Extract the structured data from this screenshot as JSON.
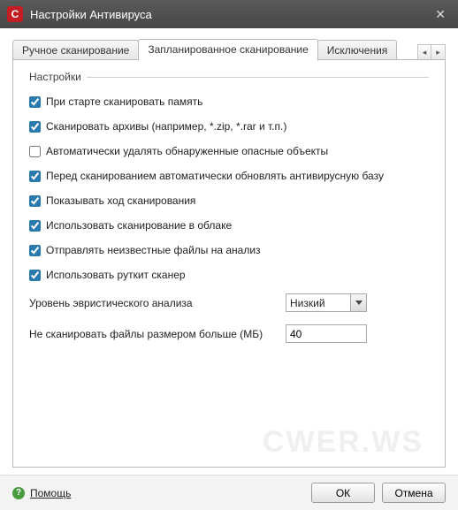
{
  "window": {
    "title": "Настройки Антивируса",
    "logo_text": "C"
  },
  "tabs": [
    {
      "label": "Ручное сканирование"
    },
    {
      "label": "Запланированное сканирование"
    },
    {
      "label": "Исключения"
    }
  ],
  "group_title": "Настройки",
  "options": [
    {
      "checked": true,
      "label": "При старте сканировать память"
    },
    {
      "checked": true,
      "label": "Сканировать архивы (например, *.zip, *.rar и т.п.)"
    },
    {
      "checked": false,
      "label": "Автоматически удалять обнаруженные опасные объекты"
    },
    {
      "checked": true,
      "label": "Перед сканированием автоматически обновлять антивирусную базу"
    },
    {
      "checked": true,
      "label": "Показывать ход сканирования"
    },
    {
      "checked": true,
      "label": "Использовать сканирование в облаке"
    },
    {
      "checked": true,
      "label": "Отправлять неизвестные файлы на анализ"
    },
    {
      "checked": true,
      "label": "Использовать руткит сканер"
    }
  ],
  "heuristic": {
    "label": "Уровень эвристического анализа",
    "value": "Низкий"
  },
  "size_limit": {
    "label": "Не сканировать файлы размером больше (МБ)",
    "value": "40"
  },
  "footer": {
    "help": "Помощь",
    "ok": "ОК",
    "cancel": "Отмена"
  },
  "watermark": "CWER.WS"
}
